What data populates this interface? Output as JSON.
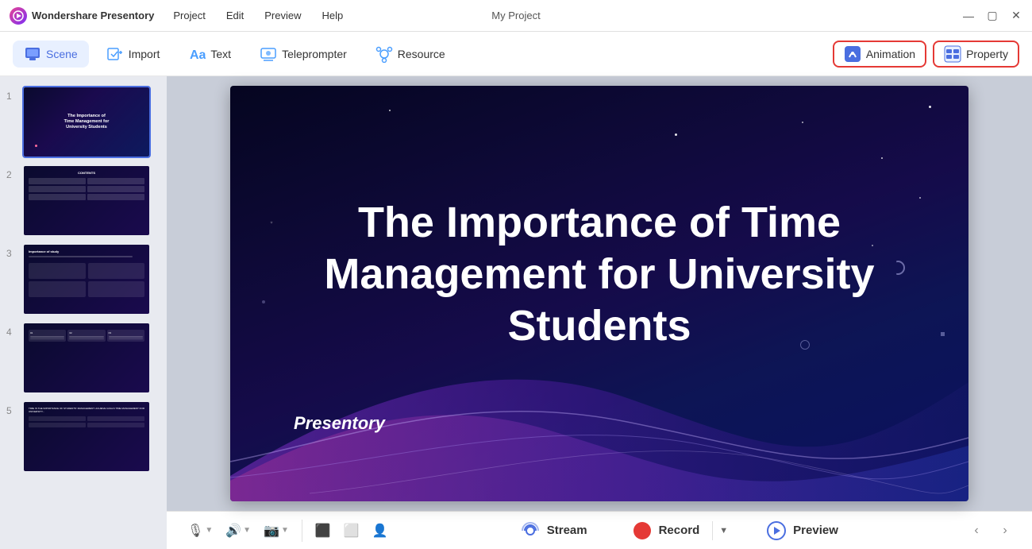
{
  "app": {
    "name": "Wondershare Presentory",
    "project_title": "My Project"
  },
  "titlebar": {
    "menus": [
      "Project",
      "Edit",
      "Preview",
      "Help"
    ],
    "controls": [
      "minimize",
      "maximize",
      "close"
    ]
  },
  "toolbar": {
    "scene_label": "Scene",
    "import_label": "Import",
    "text_label": "Text",
    "teleprompter_label": "Teleprompter",
    "resource_label": "Resource",
    "animation_label": "Animation",
    "property_label": "Property"
  },
  "slides": [
    {
      "number": "1",
      "selected": true
    },
    {
      "number": "2",
      "selected": false
    },
    {
      "number": "3",
      "selected": false
    },
    {
      "number": "4",
      "selected": false
    },
    {
      "number": "5",
      "selected": false
    }
  ],
  "canvas": {
    "main_title": "The Importance of Time Management for University Students",
    "subtitle": "Presentory"
  },
  "bottom_bar": {
    "tools": [
      "microphone",
      "speaker",
      "camera"
    ],
    "stream_label": "Stream",
    "record_label": "Record",
    "preview_label": "Preview"
  }
}
